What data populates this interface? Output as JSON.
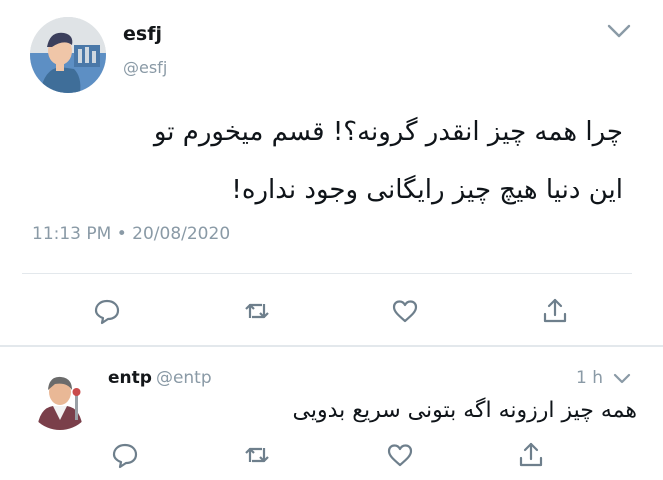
{
  "tweet": {
    "display_name": "esfj",
    "handle": "@esfj",
    "text": "چرا همه چیز انقدر گرونه؟! قسم میخورم تو\nاین دنیا هیچ چیز رایگانی وجود نداره!",
    "timestamp": "11:13 PM • 20/08/2020",
    "actions": [
      "reply-icon",
      "retweet-icon",
      "like-icon",
      "share-icon"
    ]
  },
  "reply": {
    "display_name": "entp",
    "handle": "@entp",
    "time": "1 h",
    "text": "همه چیز ارزونه اگه بتونی سریع بدویی",
    "actions": [
      "reply-icon",
      "retweet-icon",
      "like-icon",
      "share-icon"
    ]
  },
  "colors": {
    "text": "#0f1419",
    "secondary": "#8a9aa6",
    "divider": "#e3e8ec",
    "icon": "#6e7f8c"
  }
}
